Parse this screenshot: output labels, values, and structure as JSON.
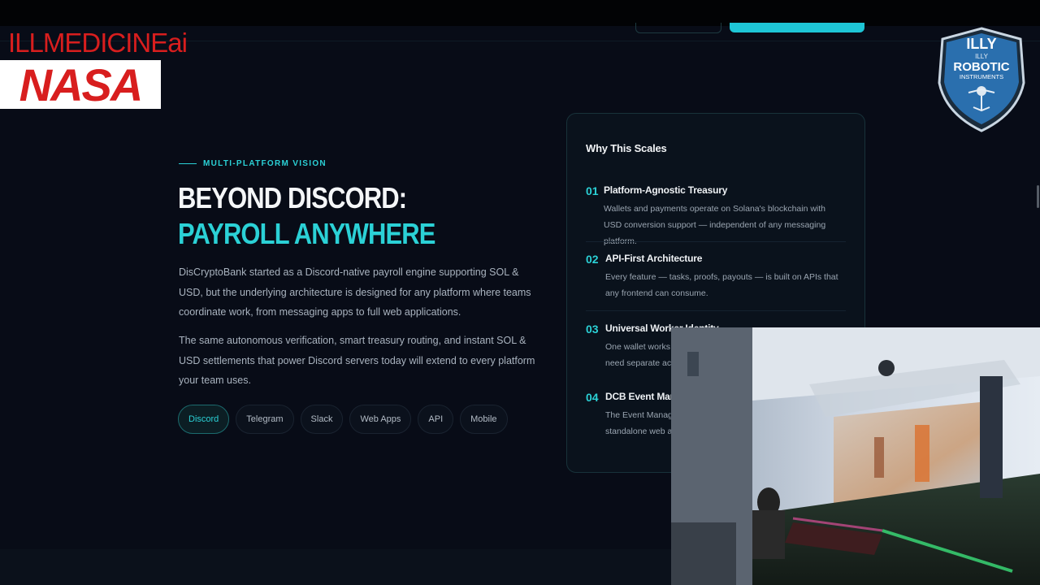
{
  "overlay": {
    "brand": "ILLMEDICINEai",
    "nasa_logo": "NASA",
    "badge_lines": [
      "ILLY",
      "ILLY",
      "ROBOTIC",
      "INSTRUMENTS"
    ]
  },
  "section": {
    "eyebrow": "MULTI-PLATFORM VISION",
    "heading_line1": "BEYOND DISCORD:",
    "heading_line2": "PAYROLL ANYWHERE",
    "paragraph1": "DisCryptoBank started as a Discord-native payroll engine supporting SOL & USD, but the underlying architecture is designed for any platform where teams coordinate work, from messaging apps to full web applications.",
    "paragraph2": "The same autonomous verification, smart treasury routing, and instant SOL & USD settlements that power Discord servers today will extend to every platform your team uses.",
    "chips": [
      "Discord",
      "Telegram",
      "Slack",
      "Web Apps",
      "API",
      "Mobile"
    ]
  },
  "card": {
    "title": "Why This Scales",
    "items": [
      {
        "num": "01",
        "title": "Platform-Agnostic Treasury",
        "desc": "Wallets and payments operate on Solana's blockchain with USD conversion support — independent of any messaging platform."
      },
      {
        "num": "02",
        "title": "API-First Architecture",
        "desc": "Every feature — tasks, proofs, payouts — is built on APIs that any frontend can consume."
      },
      {
        "num": "03",
        "title": "Universal Worker Identity",
        "desc": "One wallet works a need separate acc"
      },
      {
        "num": "04",
        "title": "DCB Event Mana",
        "desc": "The Event Manage standalone web ap"
      }
    ]
  },
  "colors": {
    "accent": "#2bd1d6",
    "background": "#080c17",
    "brand_red": "#d81e1e"
  }
}
